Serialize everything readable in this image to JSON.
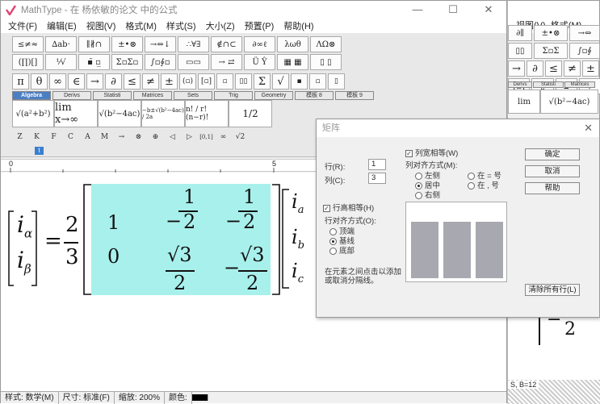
{
  "main_window": {
    "title": "MathType - 在 杨依敏的论文 中的公式",
    "menus": [
      "文件(F)",
      "编辑(E)",
      "视图(V)",
      "格式(M)",
      "样式(S)",
      "大小(Z)",
      "预置(P)",
      "帮助(H)"
    ],
    "toolbar_row1": [
      "≤≠≈",
      "∆ab·",
      "∥∦∩",
      "±•⊗",
      "→⇔↓",
      "∴∀∃",
      "∉∩⊂",
      "∂∞ℓ",
      "λωθ",
      "ΛΩ⊗"
    ],
    "toolbar_row2": [
      "(∏)[]",
      "⅟√",
      "▪̄ ▫̲",
      "Σ▫Σ▫",
      "∫▫∮▫",
      "▭▭",
      "→ ⇄",
      "Ü Ŷ",
      "▦ ▦",
      "▯ ▯"
    ],
    "toolbar_row3": [
      "π",
      "θ",
      "∞",
      "∈",
      "→",
      "∂",
      "≤",
      "≠",
      "±",
      "(▫)",
      "[▫]",
      "▫",
      "▯▯",
      "Σ",
      "√",
      "▪",
      "▫",
      "▯"
    ],
    "tabs": [
      "Algebra",
      "Derivs",
      "Statisti",
      "Matrices",
      "Sets",
      "Trig",
      "Geometry",
      "模板 8",
      "模板 9"
    ],
    "templates": [
      "√(a²+b²)",
      "lim x→∞",
      "√(b²−4ac)",
      "−b±√(b²−4ac) / 2a",
      "n! / r!(n−r)!",
      "1/2"
    ],
    "small_row": [
      "Z",
      "K",
      "F",
      "C",
      "A",
      "M",
      "→",
      "⊗",
      "⊕",
      "◁",
      "▷",
      "[0,1]",
      "∞",
      "√2"
    ],
    "ruler_labels": [
      "0",
      "5"
    ],
    "status": {
      "style": "样式: 数学(M)",
      "size": "尺寸: 标准(F)",
      "zoom": "缩放: 200%",
      "color": "颜色:"
    }
  },
  "equation": {
    "lhs": [
      "i",
      "α",
      "i",
      "β"
    ],
    "coef_num": "2",
    "coef_den": "3",
    "row1": [
      "1",
      "−",
      "1",
      "2",
      "−",
      "1",
      "2"
    ],
    "row2": [
      "0",
      "√3",
      "2",
      "−",
      "√3",
      "2"
    ],
    "rhs": [
      "i",
      "a",
      "i",
      "b",
      "i",
      "c"
    ],
    "highlight_color": "#a8f0ec"
  },
  "dialog": {
    "title": "矩阵",
    "rows_label": "行(R):",
    "rows_value": "1",
    "cols_label": "列(C):",
    "cols_value": "3",
    "equal_col_width": "列宽相等(W)",
    "col_align_label": "列对齐方式(M):",
    "col_align_opts": [
      "左侧",
      "居中",
      "右侧",
      "在 = 号",
      "在 , 号"
    ],
    "equal_row_height": "行高相等(H)",
    "row_align_label": "行对齐方式(O):",
    "row_align_opts": [
      "顶端",
      "基线",
      "底部"
    ],
    "hint": "在元素之间点击以添加或取消分隔线。",
    "ok": "确定",
    "cancel": "取消",
    "help": "帮助",
    "clear": "清除所有行(L)"
  },
  "bg_window": {
    "menus": [
      "视图(V)",
      "格式(M)"
    ],
    "status_text": "S, B=12"
  }
}
